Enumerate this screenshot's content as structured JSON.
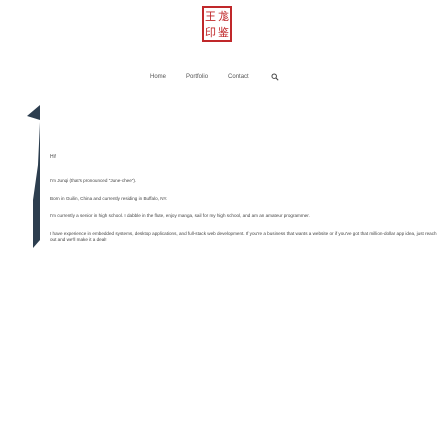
{
  "seal": {
    "chars": [
      "王",
      "尨",
      "印",
      "鉴"
    ]
  },
  "nav": {
    "items": [
      "Home",
      "Portfolio",
      "Contact"
    ],
    "search_icon": "search-icon"
  },
  "content": {
    "greeting": "Hi!",
    "paragraphs": [
      "I'm Junqi (that's pronounced \"June-chee\").",
      "Born in Guilin, China and currently residing in Buffalo, NY.",
      "I'm currently a senior in high school. I dabble in the flute, enjoy manga, sail for my high school, and am an amateur programmer.",
      "I have experience in embedded systems, desktop applications, and full-stack web development. If you're a business that wants a website or if you've got that million-dollar app idea, just reach out and we'll make it a deal!"
    ]
  },
  "colors": {
    "seal_red": "#c0282a",
    "decor_dark": "#2d3e4f"
  }
}
